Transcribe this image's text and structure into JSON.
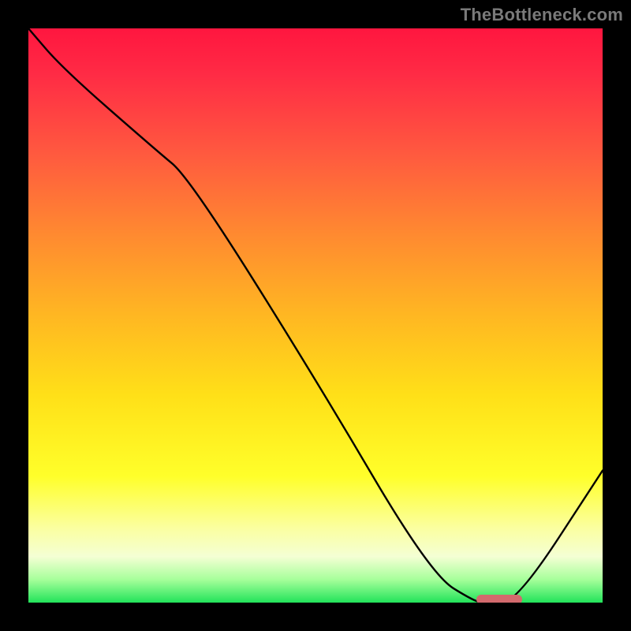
{
  "watermark": "TheBottleneck.com",
  "chart_data": {
    "type": "line",
    "title": "",
    "xlabel": "",
    "ylabel": "",
    "xlim": [
      0,
      100
    ],
    "ylim": [
      0,
      100
    ],
    "grid": false,
    "series": [
      {
        "name": "curve",
        "x": [
          0,
          6,
          22,
          28,
          50,
          70,
          78,
          80,
          85,
          100
        ],
        "y": [
          100,
          93,
          79,
          74,
          39,
          5,
          0,
          0,
          0,
          23
        ]
      }
    ],
    "marker": {
      "x_start": 78,
      "x_end": 86,
      "y": 0.5
    },
    "gradient_stops": [
      {
        "pct": 0,
        "color": "#ff163f"
      },
      {
        "pct": 8,
        "color": "#ff2b45"
      },
      {
        "pct": 22,
        "color": "#ff5a3f"
      },
      {
        "pct": 36,
        "color": "#ff8a30"
      },
      {
        "pct": 50,
        "color": "#ffb722"
      },
      {
        "pct": 64,
        "color": "#ffe018"
      },
      {
        "pct": 78,
        "color": "#ffff2a"
      },
      {
        "pct": 87,
        "color": "#fbffa0"
      },
      {
        "pct": 92,
        "color": "#f4ffd4"
      },
      {
        "pct": 96,
        "color": "#a6ff9a"
      },
      {
        "pct": 100,
        "color": "#22e35a"
      }
    ]
  }
}
